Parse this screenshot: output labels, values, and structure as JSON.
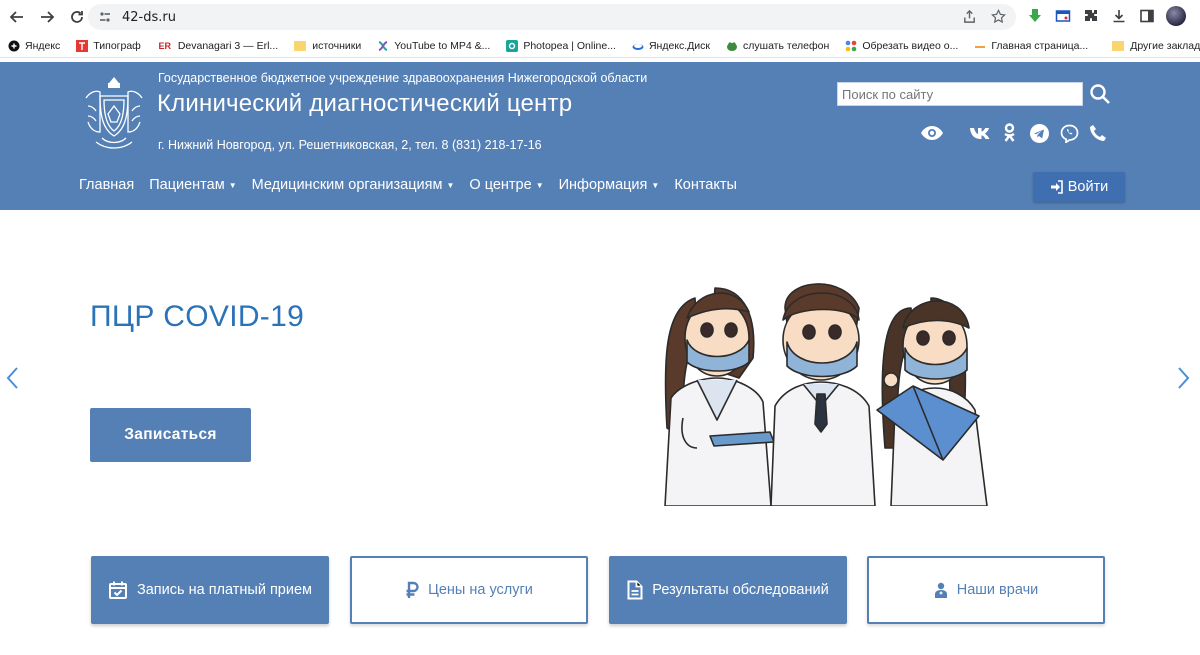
{
  "browser": {
    "url": "42-ds.ru"
  },
  "bookmarks": [
    {
      "label": "Яндекс",
      "icon": "yandex-icon"
    },
    {
      "label": "Типограф",
      "icon": "typograf-icon"
    },
    {
      "label": "Devanagari 3 — Erl...",
      "icon": "er-icon",
      "icon_text": "ER"
    },
    {
      "label": "источники",
      "icon": "folder-icon"
    },
    {
      "label": "YouTube to MP4 &...",
      "icon": "youtube-mp4-icon"
    },
    {
      "label": "Photopea | Online...",
      "icon": "photopea-icon"
    },
    {
      "label": "Яндекс.Диск",
      "icon": "yandex-disk-icon"
    },
    {
      "label": "слушать телефон",
      "icon": "frog-icon"
    },
    {
      "label": "Обрезать видео о...",
      "icon": "video-cut-icon"
    },
    {
      "label": "Главная страница...",
      "icon": "dash-icon"
    }
  ],
  "bookmarks_other": "Другие закладк",
  "header": {
    "org_subtitle": "Государственное бюджетное учреждение здравоохранения Нижегородской области",
    "org_title": "Клинический диагностический центр",
    "address": "г. Нижний Новгород, ул. Решетниковская, 2, тел. 8 (831) 218-17-16",
    "search_placeholder": "Поиск по сайту",
    "social_icons": [
      "eye-icon",
      "vk-icon",
      "ok-icon",
      "telegram-icon",
      "viber-icon",
      "phone-icon"
    ],
    "accent_color": "#5580b5"
  },
  "nav": {
    "items": [
      {
        "label": "Главная",
        "dropdown": false
      },
      {
        "label": "Пациентам",
        "dropdown": true
      },
      {
        "label": "Медицинским организациям",
        "dropdown": true
      },
      {
        "label": "О центре",
        "dropdown": true
      },
      {
        "label": "Информация",
        "dropdown": true
      },
      {
        "label": "Контакты",
        "dropdown": false
      }
    ],
    "login_label": "Войти"
  },
  "hero": {
    "title": "ПЦР COVID-19",
    "button_label": "Записаться"
  },
  "tiles": [
    {
      "label": "Запись на платный прием",
      "icon": "calendar-check-icon",
      "style": "filled"
    },
    {
      "label": "Цены на услуги",
      "icon": "ruble-icon",
      "style": "outline"
    },
    {
      "label": "Результаты обследований",
      "icon": "document-icon",
      "style": "filled"
    },
    {
      "label": "Наши врачи",
      "icon": "doctor-icon",
      "style": "outline"
    }
  ]
}
